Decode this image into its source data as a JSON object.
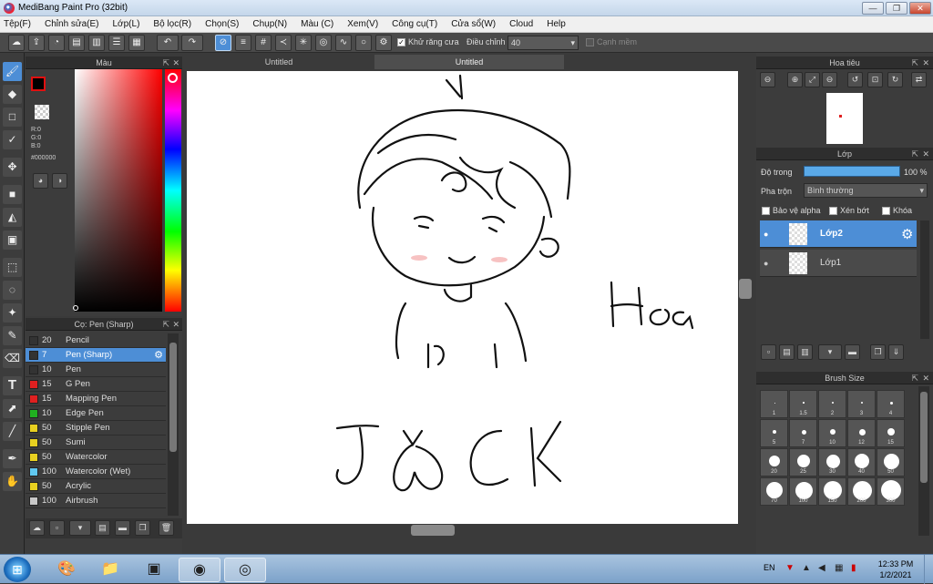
{
  "window": {
    "title": "MediBang Paint Pro (32bit)",
    "min": "—",
    "restore": "❐",
    "close": "✕"
  },
  "menu": [
    "Tệp(F)",
    "Chỉnh sửa(E)",
    "Lớp(L)",
    "Bộ lọc(R)",
    "Chọn(S)",
    "Chụp(N)",
    "Màu (C)",
    "Xem(V)",
    "Công cụ(T)",
    "Cửa sổ(W)",
    "Cloud",
    "Help"
  ],
  "toolbar": {
    "antialias_label": "Khử răng cưa",
    "adjust_label": "Điều chỉnh",
    "adjust_value": "40",
    "soft_edge_label": "Cạnh mềm"
  },
  "color_panel": {
    "title": "Màu",
    "r": "R:0",
    "g": "G:0",
    "b": "B:0",
    "hex": "#000000",
    "fg_color": "#000000"
  },
  "brush_panel": {
    "title": "Cọ: Pen (Sharp)",
    "brushes": [
      {
        "size": "20",
        "name": "Pencil",
        "color": "#333333"
      },
      {
        "size": "7",
        "name": "Pen (Sharp)",
        "color": "#333333"
      },
      {
        "size": "10",
        "name": "Pen",
        "color": "#333333"
      },
      {
        "size": "15",
        "name": "G Pen",
        "color": "#e02020"
      },
      {
        "size": "15",
        "name": "Mapping Pen",
        "color": "#e02020"
      },
      {
        "size": "10",
        "name": "Edge Pen",
        "color": "#20b020"
      },
      {
        "size": "50",
        "name": "Stipple Pen",
        "color": "#e8d020"
      },
      {
        "size": "50",
        "name": "Sumi",
        "color": "#e8d020"
      },
      {
        "size": "50",
        "name": "Watercolor",
        "color": "#e8d020"
      },
      {
        "size": "100",
        "name": "Watercolor (Wet)",
        "color": "#60c8f0"
      },
      {
        "size": "50",
        "name": "Acrylic",
        "color": "#e8d020"
      },
      {
        "size": "100",
        "name": "Airbrush",
        "color": "#c8c8c8"
      }
    ]
  },
  "tabs": [
    "Untitled",
    "Untitled"
  ],
  "canvas_text": {
    "hoa": "Hoa",
    "jack": "J    CK"
  },
  "navigator": {
    "title": "Hoa tiêu"
  },
  "layers": {
    "title": "Lớp",
    "opacity_label": "Độ trong",
    "opacity_value": "100 %",
    "blend_label": "Pha trộn",
    "blend_value": "Bình thường",
    "alpha_protect": "Bảo vệ alpha",
    "clip": "Xén bớt",
    "lock": "Khóa",
    "items": [
      {
        "name": "Lớp2"
      },
      {
        "name": "Lớp1"
      }
    ]
  },
  "brush_size": {
    "title": "Brush Size",
    "sizes": [
      "1",
      "1.5",
      "2",
      "3",
      "4",
      "5",
      "7",
      "10",
      "12",
      "15",
      "20",
      "25",
      "30",
      "40",
      "50",
      "70",
      "100",
      "150",
      "200",
      "300"
    ]
  },
  "taskbar": {
    "lang": "EN",
    "time": "12:33 PM",
    "date": "1/2/2021"
  }
}
